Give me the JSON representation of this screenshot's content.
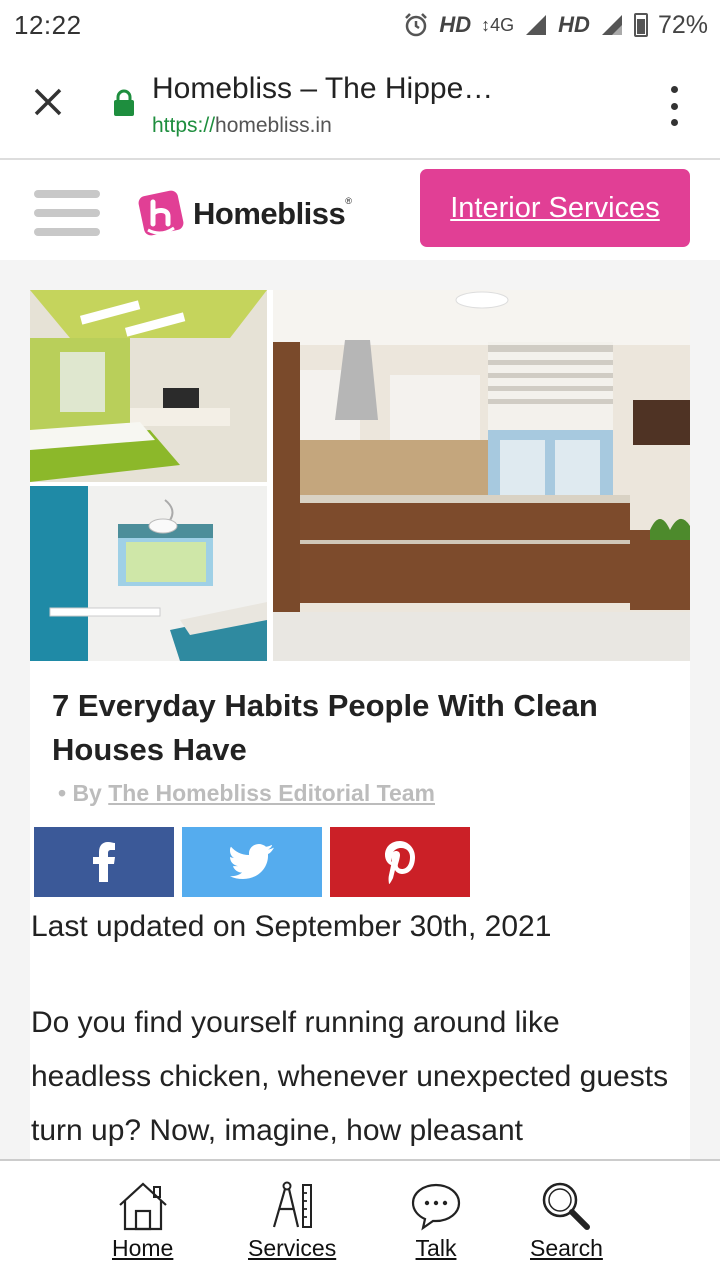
{
  "status_bar": {
    "time": "12:22",
    "network_1": "HD",
    "network_type": "4G",
    "network_2": "HD",
    "battery": "72%"
  },
  "browser": {
    "title": "Homebliss – The Hippe…",
    "url_scheme": "https://",
    "url_host": "homebliss.in"
  },
  "header": {
    "logo_text": "Homebliss",
    "logo_mark": "®",
    "cta_label": "Interior Services",
    "brand_color": "#e13f95"
  },
  "article": {
    "title": "7 Everyday Habits People With Clean Houses Have",
    "byline_prefix": "• By",
    "author": "The Homebliss Editorial Team",
    "last_updated": "Last updated on September 30th, 2021",
    "body": "Do you find yourself running around like headless chicken, whenever unexpected guests turn up? Now, imagine, how pleasant"
  },
  "share": {
    "facebook_icon": "facebook-icon",
    "twitter_icon": "twitter-icon",
    "pinterest_icon": "pinterest-icon"
  },
  "bottom_nav": {
    "items": [
      {
        "label": "Home",
        "icon": "home-icon"
      },
      {
        "label": "Services",
        "icon": "tools-icon"
      },
      {
        "label": "Talk",
        "icon": "chat-icon"
      },
      {
        "label": "Search",
        "icon": "search-icon"
      }
    ]
  }
}
